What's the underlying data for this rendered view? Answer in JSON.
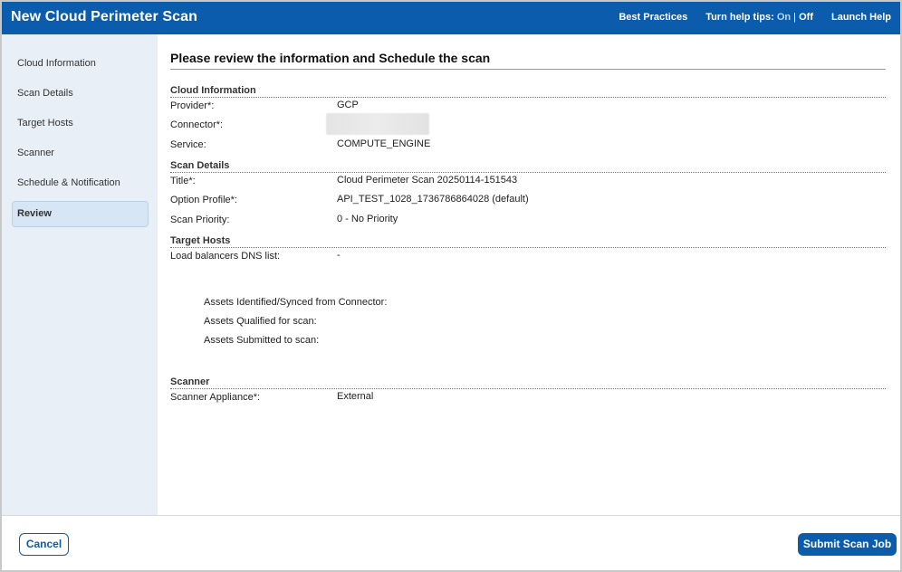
{
  "header": {
    "title": "New Cloud Perimeter Scan",
    "best_practices": "Best Practices",
    "help_tips_label": "Turn help tips:",
    "help_tips_on": "On",
    "help_tips_sep": "|",
    "help_tips_off": "Off",
    "launch_help": "Launch Help"
  },
  "sidebar": {
    "items": [
      {
        "label": "Cloud Information"
      },
      {
        "label": "Scan Details"
      },
      {
        "label": "Target Hosts"
      },
      {
        "label": "Scanner"
      },
      {
        "label": "Schedule & Notification"
      },
      {
        "label": "Review",
        "active": true
      }
    ]
  },
  "main": {
    "title": "Please review the information and Schedule the scan",
    "cloud_information": {
      "heading": "Cloud Information",
      "provider_label": "Provider*:",
      "provider_value": "GCP",
      "connector_label": "Connector*:",
      "service_label": "Service:",
      "service_value": "COMPUTE_ENGINE"
    },
    "scan_details": {
      "heading": "Scan Details",
      "title_label": "Title*:",
      "title_value": "Cloud Perimeter Scan 20250114-151543",
      "option_profile_label": "Option Profile*:",
      "option_profile_value": "API_TEST_1028_1736786864028 (default)",
      "scan_priority_label": "Scan Priority:",
      "scan_priority_value": "0 - No Priority"
    },
    "target_hosts": {
      "heading": "Target Hosts",
      "lb_dns_label": "Load balancers DNS list:",
      "lb_dns_value": "-",
      "assets_identified_label": "Assets Identified/Synced from Connector:",
      "assets_qualified_label": "Assets Qualified for scan:",
      "assets_submitted_label": "Assets Submitted to scan:"
    },
    "scanner": {
      "heading": "Scanner",
      "appliance_label": "Scanner Appliance*:",
      "appliance_value": "External"
    }
  },
  "footer": {
    "cancel_label": "Cancel",
    "submit_label": "Submit Scan Job"
  }
}
